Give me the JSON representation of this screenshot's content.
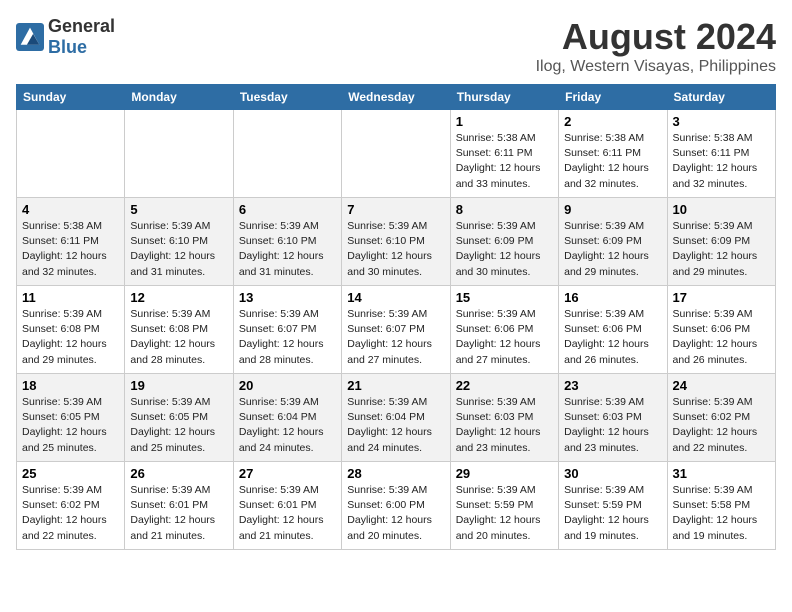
{
  "logo": {
    "general": "General",
    "blue": "Blue"
  },
  "title": "August 2024",
  "subtitle": "Ilog, Western Visayas, Philippines",
  "days_of_week": [
    "Sunday",
    "Monday",
    "Tuesday",
    "Wednesday",
    "Thursday",
    "Friday",
    "Saturday"
  ],
  "weeks": [
    [
      {
        "day": "",
        "detail": ""
      },
      {
        "day": "",
        "detail": ""
      },
      {
        "day": "",
        "detail": ""
      },
      {
        "day": "",
        "detail": ""
      },
      {
        "day": "1",
        "detail": "Sunrise: 5:38 AM\nSunset: 6:11 PM\nDaylight: 12 hours\nand 33 minutes."
      },
      {
        "day": "2",
        "detail": "Sunrise: 5:38 AM\nSunset: 6:11 PM\nDaylight: 12 hours\nand 32 minutes."
      },
      {
        "day": "3",
        "detail": "Sunrise: 5:38 AM\nSunset: 6:11 PM\nDaylight: 12 hours\nand 32 minutes."
      }
    ],
    [
      {
        "day": "4",
        "detail": "Sunrise: 5:38 AM\nSunset: 6:11 PM\nDaylight: 12 hours\nand 32 minutes."
      },
      {
        "day": "5",
        "detail": "Sunrise: 5:39 AM\nSunset: 6:10 PM\nDaylight: 12 hours\nand 31 minutes."
      },
      {
        "day": "6",
        "detail": "Sunrise: 5:39 AM\nSunset: 6:10 PM\nDaylight: 12 hours\nand 31 minutes."
      },
      {
        "day": "7",
        "detail": "Sunrise: 5:39 AM\nSunset: 6:10 PM\nDaylight: 12 hours\nand 30 minutes."
      },
      {
        "day": "8",
        "detail": "Sunrise: 5:39 AM\nSunset: 6:09 PM\nDaylight: 12 hours\nand 30 minutes."
      },
      {
        "day": "9",
        "detail": "Sunrise: 5:39 AM\nSunset: 6:09 PM\nDaylight: 12 hours\nand 29 minutes."
      },
      {
        "day": "10",
        "detail": "Sunrise: 5:39 AM\nSunset: 6:09 PM\nDaylight: 12 hours\nand 29 minutes."
      }
    ],
    [
      {
        "day": "11",
        "detail": "Sunrise: 5:39 AM\nSunset: 6:08 PM\nDaylight: 12 hours\nand 29 minutes."
      },
      {
        "day": "12",
        "detail": "Sunrise: 5:39 AM\nSunset: 6:08 PM\nDaylight: 12 hours\nand 28 minutes."
      },
      {
        "day": "13",
        "detail": "Sunrise: 5:39 AM\nSunset: 6:07 PM\nDaylight: 12 hours\nand 28 minutes."
      },
      {
        "day": "14",
        "detail": "Sunrise: 5:39 AM\nSunset: 6:07 PM\nDaylight: 12 hours\nand 27 minutes."
      },
      {
        "day": "15",
        "detail": "Sunrise: 5:39 AM\nSunset: 6:06 PM\nDaylight: 12 hours\nand 27 minutes."
      },
      {
        "day": "16",
        "detail": "Sunrise: 5:39 AM\nSunset: 6:06 PM\nDaylight: 12 hours\nand 26 minutes."
      },
      {
        "day": "17",
        "detail": "Sunrise: 5:39 AM\nSunset: 6:06 PM\nDaylight: 12 hours\nand 26 minutes."
      }
    ],
    [
      {
        "day": "18",
        "detail": "Sunrise: 5:39 AM\nSunset: 6:05 PM\nDaylight: 12 hours\nand 25 minutes."
      },
      {
        "day": "19",
        "detail": "Sunrise: 5:39 AM\nSunset: 6:05 PM\nDaylight: 12 hours\nand 25 minutes."
      },
      {
        "day": "20",
        "detail": "Sunrise: 5:39 AM\nSunset: 6:04 PM\nDaylight: 12 hours\nand 24 minutes."
      },
      {
        "day": "21",
        "detail": "Sunrise: 5:39 AM\nSunset: 6:04 PM\nDaylight: 12 hours\nand 24 minutes."
      },
      {
        "day": "22",
        "detail": "Sunrise: 5:39 AM\nSunset: 6:03 PM\nDaylight: 12 hours\nand 23 minutes."
      },
      {
        "day": "23",
        "detail": "Sunrise: 5:39 AM\nSunset: 6:03 PM\nDaylight: 12 hours\nand 23 minutes."
      },
      {
        "day": "24",
        "detail": "Sunrise: 5:39 AM\nSunset: 6:02 PM\nDaylight: 12 hours\nand 22 minutes."
      }
    ],
    [
      {
        "day": "25",
        "detail": "Sunrise: 5:39 AM\nSunset: 6:02 PM\nDaylight: 12 hours\nand 22 minutes."
      },
      {
        "day": "26",
        "detail": "Sunrise: 5:39 AM\nSunset: 6:01 PM\nDaylight: 12 hours\nand 21 minutes."
      },
      {
        "day": "27",
        "detail": "Sunrise: 5:39 AM\nSunset: 6:01 PM\nDaylight: 12 hours\nand 21 minutes."
      },
      {
        "day": "28",
        "detail": "Sunrise: 5:39 AM\nSunset: 6:00 PM\nDaylight: 12 hours\nand 20 minutes."
      },
      {
        "day": "29",
        "detail": "Sunrise: 5:39 AM\nSunset: 5:59 PM\nDaylight: 12 hours\nand 20 minutes."
      },
      {
        "day": "30",
        "detail": "Sunrise: 5:39 AM\nSunset: 5:59 PM\nDaylight: 12 hours\nand 19 minutes."
      },
      {
        "day": "31",
        "detail": "Sunrise: 5:39 AM\nSunset: 5:58 PM\nDaylight: 12 hours\nand 19 minutes."
      }
    ]
  ]
}
